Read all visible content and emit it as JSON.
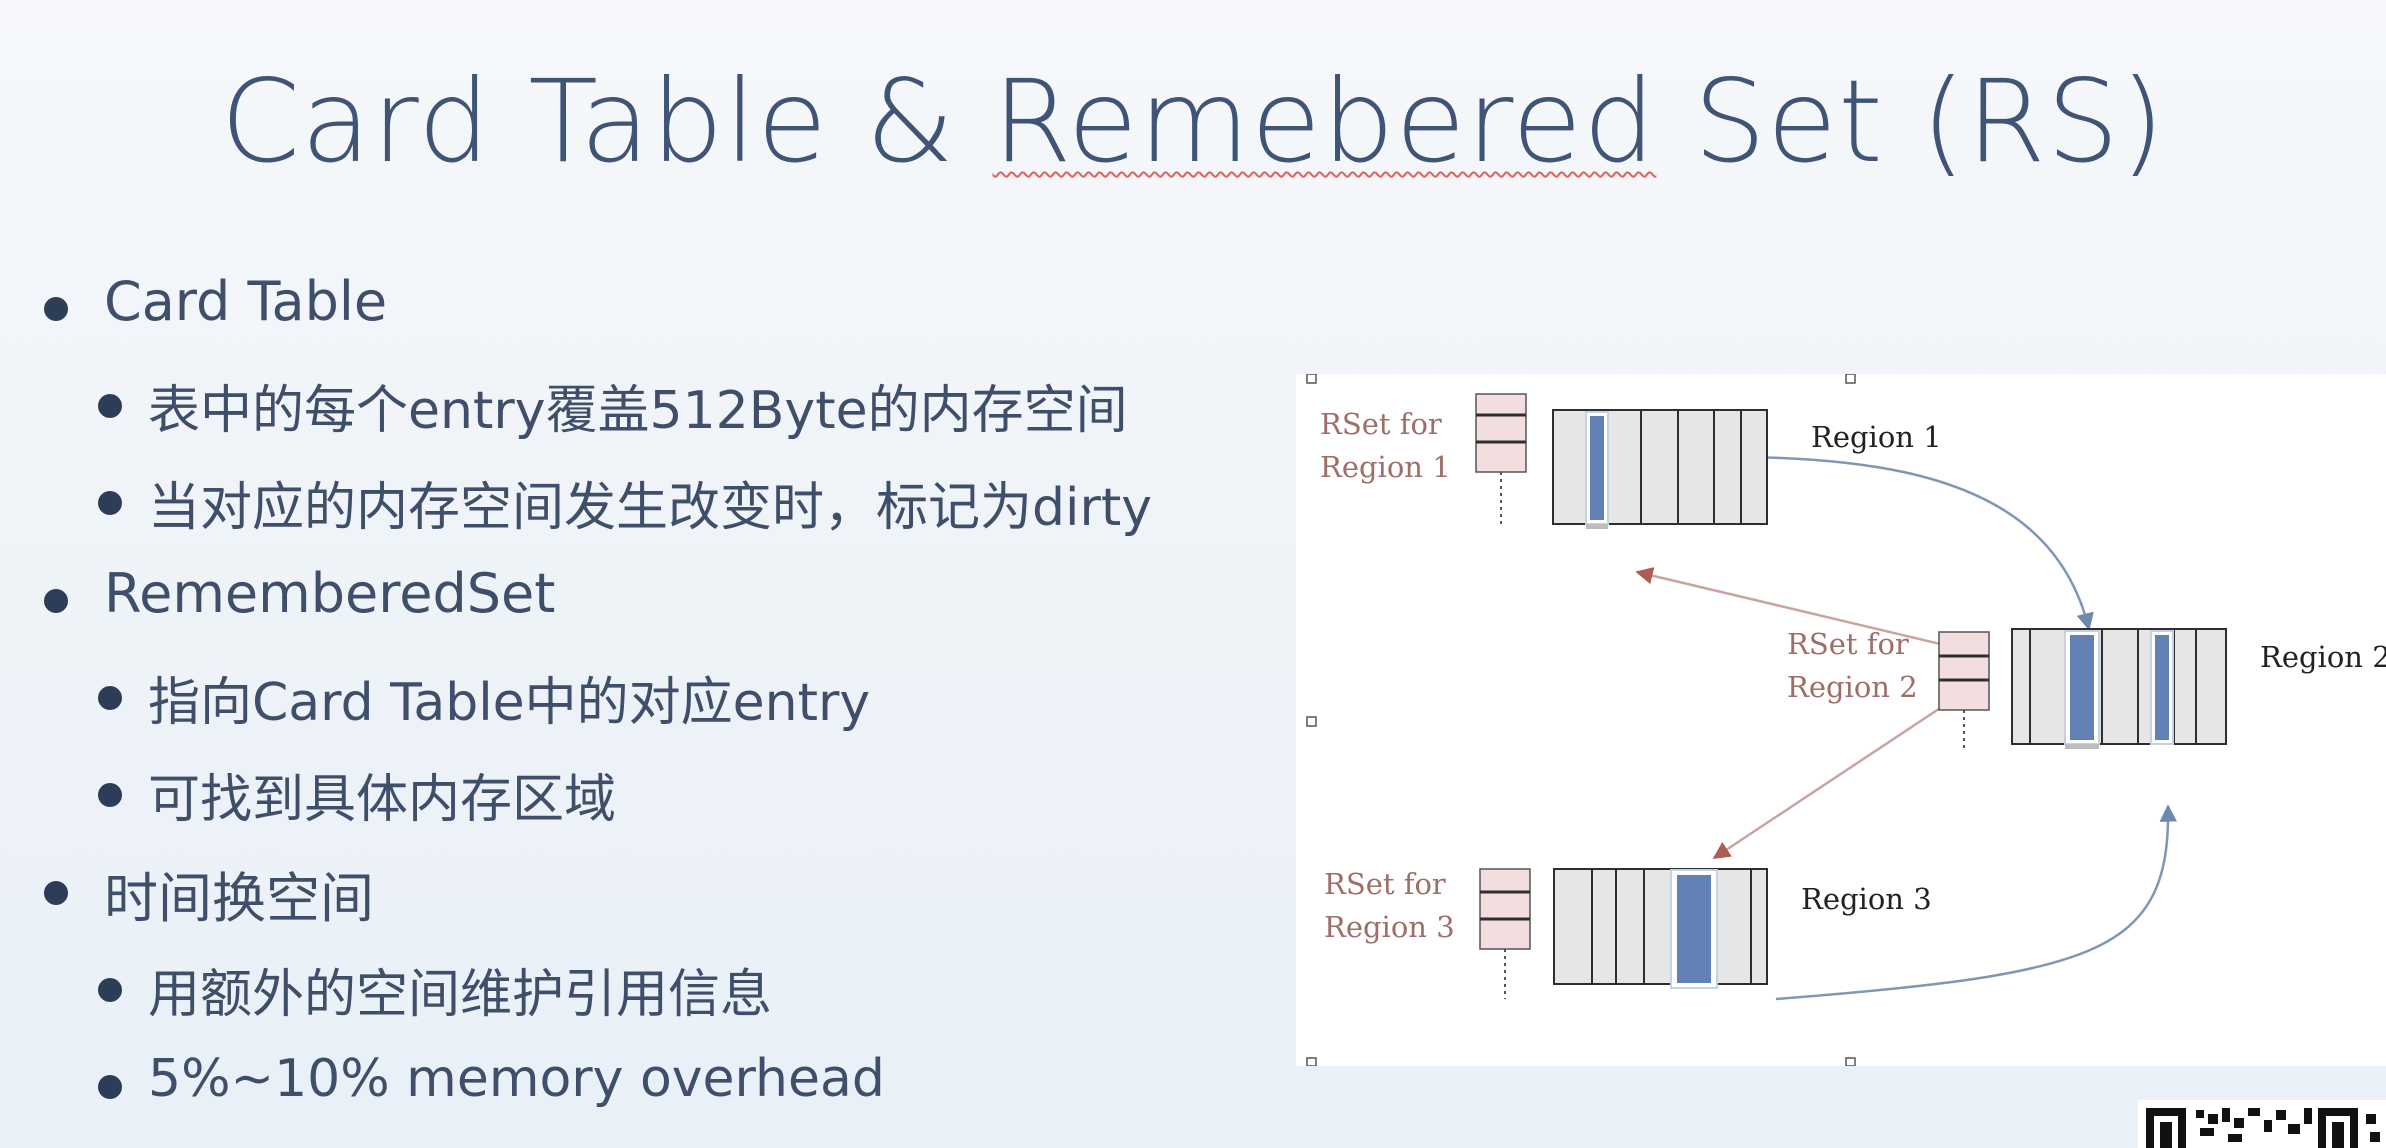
{
  "slide": {
    "title_prefix": "Card Table & ",
    "title_flagged_word": "Remebered",
    "title_suffix": " Set (RS)"
  },
  "bullets": [
    {
      "level": 1,
      "text": "Card Table"
    },
    {
      "level": 2,
      "text": "表中的每个entry覆盖512Byte的内存空间"
    },
    {
      "level": 2,
      "text": "当对应的内存空间发生改变时，标记为dirty"
    },
    {
      "level": 1,
      "text": "RememberedSet"
    },
    {
      "level": 2,
      "text": "指向Card Table中的对应entry"
    },
    {
      "level": 2,
      "text": "可找到具体内存区域"
    },
    {
      "level": 1,
      "text": "时间换空间"
    },
    {
      "level": 2,
      "text": "用额外的空间维护引用信息"
    },
    {
      "level": 2,
      "text": "5%~10% memory overhead"
    }
  ],
  "diagram": {
    "rset_labels": {
      "region1": {
        "line1": "RSet for",
        "line2": "Region 1"
      },
      "region2": {
        "line1": "RSet for",
        "line2": "Region 2"
      },
      "region3": {
        "line1": "RSet for",
        "line2": "Region 3"
      }
    },
    "region_labels": {
      "region1": "Region 1",
      "region2": "Region 2",
      "region3": "Region 3"
    },
    "colors": {
      "card_fill": "#e6e6e6",
      "card_stroke": "#2e2e2e",
      "dirty_card": "#6281b5",
      "rset_fill": "#f2dede",
      "rset_label": "#9e6e68",
      "arrow_blue": "#7f97b4",
      "arrow_red": "#c9a4a1",
      "arrowhead_red": "#b05c50"
    }
  },
  "colors": {
    "title": "#3f5476",
    "body_text": "#3f4f6a",
    "bullet_dot": "#2d3d58",
    "spellcheck_underline": "#e0625d"
  }
}
